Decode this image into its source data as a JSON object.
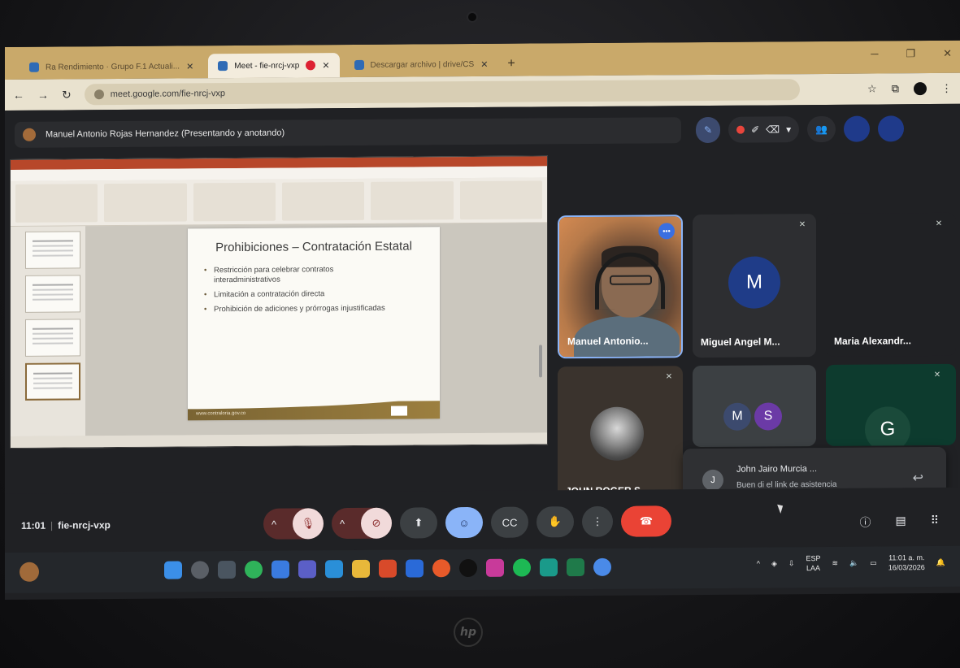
{
  "browser": {
    "tabs": [
      {
        "label": "Ra Rendimiento · Grupo F.1 Actuali...",
        "active": false
      },
      {
        "label": "Meet - fie-nrcj-vxp",
        "active": true
      },
      {
        "label": "Descargar archivo | drive/CS",
        "active": false
      }
    ],
    "new_tab": "+",
    "url": "meet.google.com/fie-nrcj-vxp"
  },
  "meet": {
    "presenter_text": "Manuel Antonio Rojas Hernandez (Presentando y anotando)",
    "meeting_time": "11:01",
    "meeting_code": "fie-nrcj-vxp",
    "reactions": [
      "💖",
      "👍",
      "🎉",
      "👏",
      "😂",
      "😮",
      "😢",
      "🤔",
      "👎",
      "☺"
    ]
  },
  "slide": {
    "title": "Prohibiciones – Contratación Estatal",
    "bullets": [
      "Restricción para celebrar contratos interadministrativos",
      "Limitación a contratación directa",
      "Prohibición de adiciones y prórrogas injustificadas"
    ],
    "footer_url": "www.contraloria.gov.co"
  },
  "participants": [
    {
      "name": "Manuel Antonio...",
      "type": "camera"
    },
    {
      "name": "Miguel Angel M...",
      "initial": "M",
      "color": "#1f3c88"
    },
    {
      "name": "Maria Alexandr...",
      "initial": "",
      "color": "#3c4043"
    },
    {
      "name": "JOHN ROGER S...",
      "type": "photo"
    },
    {
      "initials": [
        "M",
        "S"
      ],
      "colors": [
        "#3c4a6e",
        "#6b3aa6"
      ]
    },
    {
      "initial": "G",
      "color": "#0d3b2e"
    }
  ],
  "chat_toast": {
    "initial": "J",
    "sender": "John Jairo Murcia ...",
    "message": "Buen di el link de asistencia"
  },
  "taskbar": {
    "lang_top": "ESP",
    "lang_bottom": "LAA",
    "time": "11:01 a. m.",
    "date": "16/03/2026"
  },
  "colors": {
    "meet_bg": "#202124",
    "hangup": "#ea4335",
    "active_control": "#8ab4f8",
    "tab_bar": "#c9a96a"
  }
}
